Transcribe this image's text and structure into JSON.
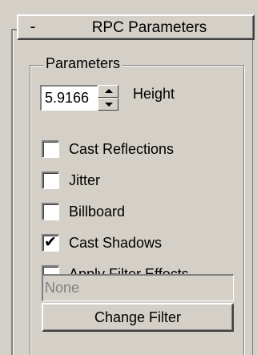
{
  "rollout": {
    "collapse_symbol": "-",
    "title": "RPC Parameters"
  },
  "group": {
    "label": "Parameters"
  },
  "height_spinner": {
    "value": "5.9166",
    "label": "Height"
  },
  "checkboxes": [
    {
      "label": "Cast Reflections",
      "checked": false
    },
    {
      "label": "Jitter",
      "checked": false
    },
    {
      "label": "Billboard",
      "checked": false
    },
    {
      "label": "Cast Shadows",
      "checked": true
    },
    {
      "label": "Apply Filter Effects",
      "checked": false
    }
  ],
  "filter": {
    "value": "None",
    "button_label": "Change Filter"
  },
  "colors": {
    "panel_bg": "#d4d0c8",
    "disabled_text": "#808080"
  }
}
